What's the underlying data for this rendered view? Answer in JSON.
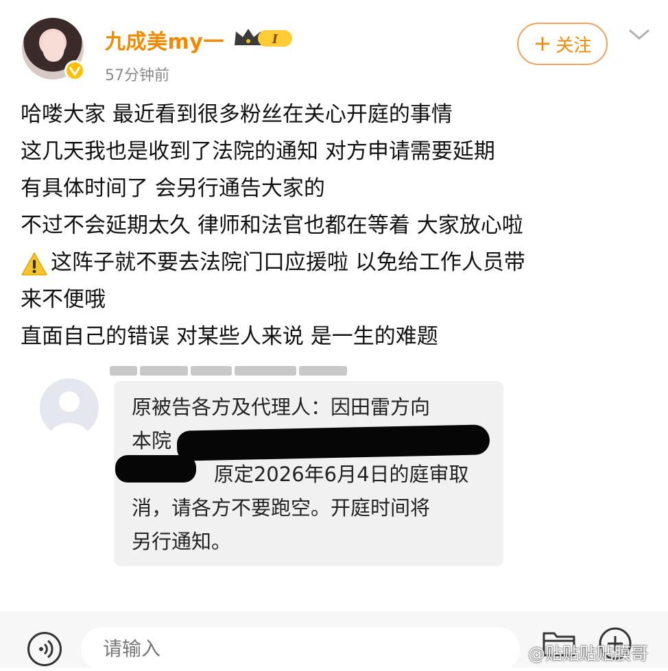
{
  "header": {
    "username": "九成美my一",
    "time": "57分钟前",
    "follow_label": "关注",
    "follow_plus": "+",
    "level_badge": "I"
  },
  "post": {
    "lines": [
      "哈喽大家  最近看到很多粉丝在关心开庭的事情",
      "这几天我也是收到了法院的通知  对方申请需要延期",
      "有具体时间了  会另行通告大家的",
      "不过不会延期太久  律师和法官也都在等着  大家放心啦",
      "这阵子就不要去法院门口应援啦  以免给工作人员带",
      "来不便哦",
      "直面自己的错误  对某些人来说  是一生的难题"
    ]
  },
  "notice": {
    "lines": [
      "原被告各方及代理人：因田雷方向",
      "本院",
      "             原定2026年6月4日的庭审取",
      "消，请各方不要跑空。开庭时间将",
      "另行通知。"
    ]
  },
  "bottombar": {
    "input_placeholder": "请输入",
    "watermark": "@贴贴贴贴膜哥"
  },
  "colors": {
    "accent": "#f08a00",
    "follow_border": "#f5a05a",
    "bubble_bg": "#f1f1f1"
  },
  "icons": [
    "verified-v-icon",
    "crown-level-icon",
    "chevron-down-icon",
    "warning-icon",
    "default-avatar-icon",
    "voice-icon",
    "folder-icon",
    "add-circle-icon"
  ]
}
